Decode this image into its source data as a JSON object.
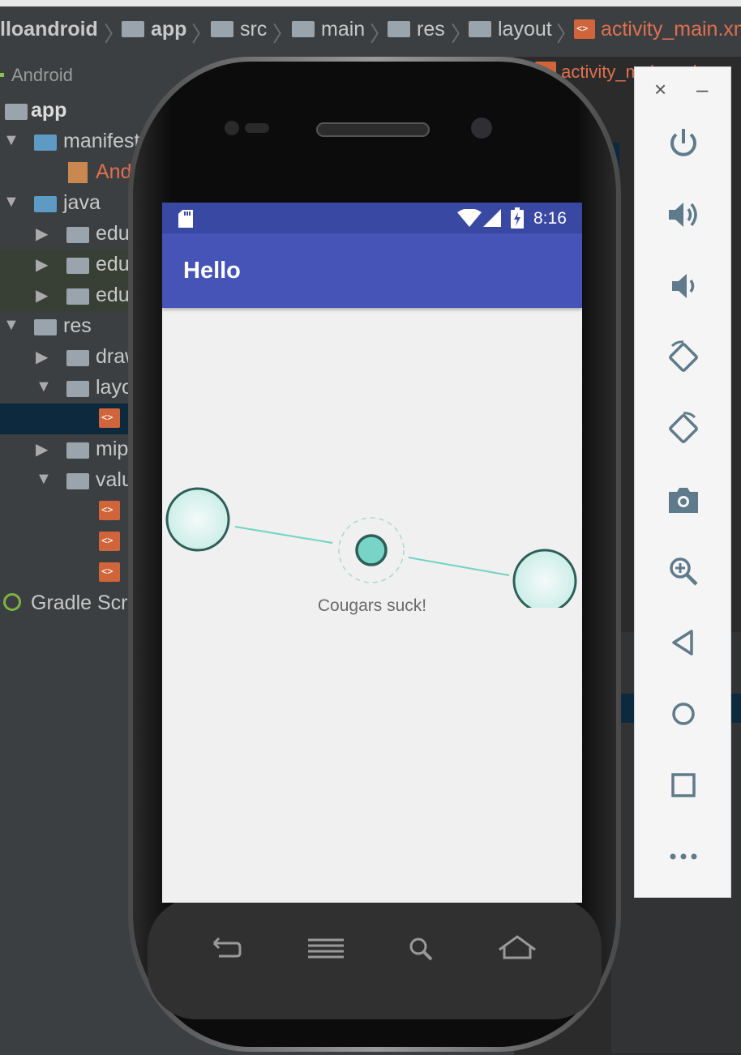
{
  "breadcrumb": {
    "items": [
      "lloandroid",
      "app",
      "src",
      "main",
      "res",
      "layout",
      "activity_main.xml"
    ]
  },
  "project": {
    "header": "Android",
    "tree": [
      {
        "label": "app",
        "bold": true
      },
      {
        "label": "manifests"
      },
      {
        "label": "AndroidManifest.xml"
      },
      {
        "label": "java"
      },
      {
        "label": "edu"
      },
      {
        "label": "edu"
      },
      {
        "label": "edu"
      },
      {
        "label": "res"
      },
      {
        "label": "drawable"
      },
      {
        "label": "layout"
      },
      {
        "label": "mipmap"
      },
      {
        "label": "values"
      },
      {
        "label": "Gradle Scripts"
      }
    ]
  },
  "editor": {
    "tab_label": "activity_main.xml"
  },
  "device": {
    "status_time": "8:16",
    "app_title": "Hello",
    "message": "Cougars suck!"
  },
  "emulator_toolbar": {
    "close_label": "×",
    "minimize_label": "–",
    "buttons": [
      "power-icon",
      "volume-up-icon",
      "volume-down-icon",
      "rotate-left-icon",
      "rotate-right-icon",
      "camera-icon",
      "zoom-icon",
      "back-icon",
      "home-icon",
      "overview-icon",
      "more-icon"
    ]
  },
  "colors": {
    "statusbar": "#3949a3",
    "appbar": "#4654b8",
    "accent": "#77d4c6",
    "node_stroke": "#2d5e58"
  }
}
